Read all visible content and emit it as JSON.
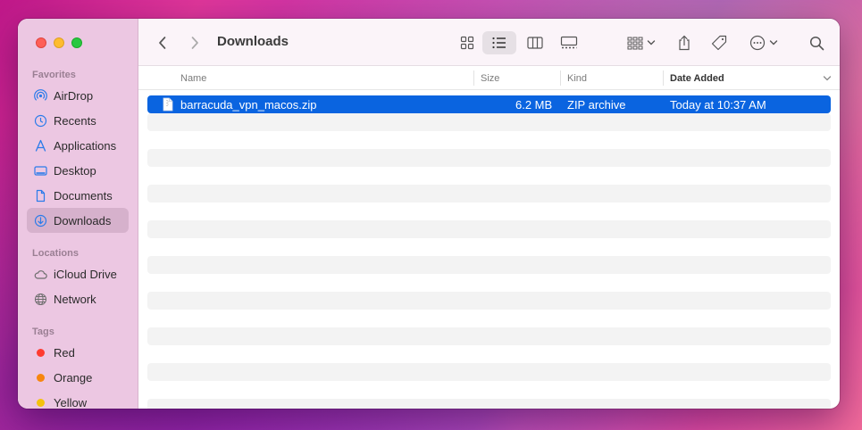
{
  "window": {
    "title": "Downloads"
  },
  "sidebar": {
    "favorites_title": "Favorites",
    "favorites": [
      {
        "label": "AirDrop"
      },
      {
        "label": "Recents"
      },
      {
        "label": "Applications"
      },
      {
        "label": "Desktop"
      },
      {
        "label": "Documents"
      },
      {
        "label": "Downloads",
        "active": true
      }
    ],
    "locations_title": "Locations",
    "locations": [
      {
        "label": "iCloud Drive"
      },
      {
        "label": "Network"
      }
    ],
    "tags_title": "Tags",
    "tags": [
      {
        "label": "Red",
        "color": "#fe3b30"
      },
      {
        "label": "Orange",
        "color": "#f7860e"
      },
      {
        "label": "Yellow",
        "color": "#f4c20d"
      }
    ]
  },
  "columns": {
    "name": "Name",
    "size": "Size",
    "kind": "Kind",
    "date_added": "Date Added"
  },
  "files": [
    {
      "name": "barracuda_vpn_macos.zip",
      "size": "6.2 MB",
      "kind": "ZIP archive",
      "date_added": "Today at 10:37 AM",
      "selected": true
    }
  ],
  "colors": {
    "accent": "#0a64e0",
    "sidebar_bg": "#ecc7e2"
  }
}
